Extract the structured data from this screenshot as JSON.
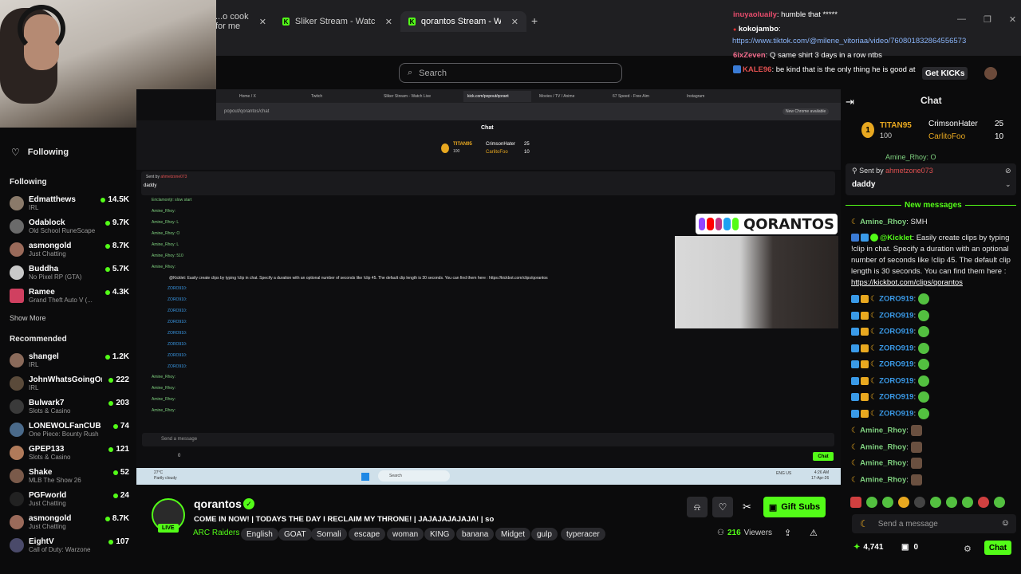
{
  "browser": {
    "tabs": [
      {
        "label": "...o cook for me"
      },
      {
        "label": "Sliker Stream - Watch Live on K"
      },
      {
        "label": "qorantos Stream - Watch Live o"
      }
    ],
    "new_tab": "+"
  },
  "topbar": {
    "search_placeholder": "Search",
    "get_kicks": "Get KICKs"
  },
  "overlay_chat": [
    {
      "user": "inuyaoluaily",
      "text": ": humble that *****",
      "color": "#e74c6c"
    },
    {
      "user": "kokojambo",
      "text": ":",
      "color": "#ffffff"
    },
    {
      "user": "",
      "text": "https://www.tiktok.com/@milene_vitoriaa/video/760801832864556573",
      "color": "#8ab4f8"
    },
    {
      "user": "6ixZeven",
      "text": ": Q same shirt 3 days in a row ntbs",
      "color": "#f06a8a"
    },
    {
      "user": "KALE96",
      "text": ": be kind that is the only thing he is good at",
      "color": "#e05050"
    }
  ],
  "sidebar": {
    "following_header": "Following",
    "following_section": "Following",
    "following": [
      {
        "name": "Edmatthews",
        "category": "IRL",
        "viewers": "14.5K"
      },
      {
        "name": "Odablock",
        "category": "Old School RuneScape",
        "viewers": "9.7K"
      },
      {
        "name": "asmongold",
        "category": "Just Chatting",
        "viewers": "8.7K"
      },
      {
        "name": "Buddha",
        "category": "No Pixel RP (GTA)",
        "viewers": "5.7K"
      },
      {
        "name": "Ramee",
        "category": "Grand Theft Auto V (...",
        "viewers": "4.3K"
      }
    ],
    "show_more": "Show More",
    "recommended_section": "Recommended",
    "recommended": [
      {
        "name": "shangel",
        "category": "IRL",
        "viewers": "1.2K"
      },
      {
        "name": "JohnWhatsGoingOn",
        "category": "IRL",
        "viewers": "222"
      },
      {
        "name": "Bulwark7",
        "category": "Slots & Casino",
        "viewers": "203"
      },
      {
        "name": "LONEWOLFanCUB",
        "category": "One Piece: Bounty Rush",
        "viewers": "74"
      },
      {
        "name": "GPEP133",
        "category": "Slots & Casino",
        "viewers": "121"
      },
      {
        "name": "Shake",
        "category": "MLB The Show 26",
        "viewers": "52"
      },
      {
        "name": "PGFworld",
        "category": "Just Chatting",
        "viewers": "24"
      },
      {
        "name": "asmongold",
        "category": "Just Chatting",
        "viewers": "8.7K"
      },
      {
        "name": "EightV",
        "category": "Call of Duty: Warzone",
        "viewers": "107"
      }
    ]
  },
  "inner_window": {
    "tabs": [
      "Home / X",
      "Twitch",
      "Sliker Stream - Watch Live",
      "kick.com/popout/qorant",
      "Movies / TV / Anime",
      "67 Speed - Free Aim",
      "Instagram"
    ],
    "address": "popout/qorantos/chat",
    "chat_title": "Chat",
    "chrome_update": "New Chrome available",
    "top_user": "TITAN95",
    "top_user_count": "100",
    "second_user": "CrimsonHater",
    "second_count": "25",
    "third_user": "CarlitoFoo",
    "third_count": "10",
    "pinned_sent_by": "Sent by",
    "pinned_author": "ahmetzone073",
    "pinned_text": "daddy",
    "lines": [
      "Ericlamontjr: slow start",
      "Amine_Rhoy:",
      "Amine_Rhoy: L",
      "Amine_Rhoy: O",
      "Amine_Rhoy: L",
      "Amine_Rhoy: 510",
      "Amine_Rhoy:",
      "@Kicklet: Easily create clips by typing !clip in chat. Specify a duration with an optional number of seconds like !clip 45. The default clip length is 30 seconds. You can find them here : https://kickbot.com/clips/qorantos",
      "ZORO910:",
      "ZORO910:",
      "ZORO910:",
      "ZORO910:",
      "ZORO910:",
      "ZORO910:",
      "ZORO910:",
      "ZORO910:",
      "Amine_Rhoy:",
      "Amine_Rhoy:",
      "Amine_Rhoy:",
      "Amine_Rhoy:"
    ],
    "send_placeholder": "Send a message",
    "kicks": "0",
    "chat_button": "Chat",
    "overlay_brand": "QORANTOS",
    "taskbar_search": "Search",
    "weather_temp": "27°C",
    "weather_desc": "Partly cloudy",
    "taskbar_time": "4:26 AM",
    "taskbar_date": "17-Apr-26",
    "taskbar_lang": "ENG US"
  },
  "right_chat": {
    "title": "Chat",
    "top_user": "TITAN95",
    "top_user_count": "100",
    "second_user": "CrimsonHater",
    "second_count": "25",
    "third_user": "CarlitoFoo",
    "third_count": "10",
    "cut_user": "Amine_Rhoy: O",
    "pinned_sent_by": "Sent by",
    "pinned_author": "ahmetzone073",
    "pinned_text": "daddy",
    "new_messages": "New messages",
    "messages": [
      {
        "user": "Amine_Rhoy",
        "text": ": SMH"
      },
      {
        "user": "@Kicklet",
        "text": ": Easily create clips by typing !clip in chat. Specify a duration with an optional number of seconds like !clip 45. The default clip length is 30 seconds. You can find them here : ",
        "link": "https://kickbot.com/clips/qorantos"
      }
    ],
    "zoro_lines": [
      "ZORO919",
      "ZORO919",
      "ZORO919",
      "ZORO919",
      "ZORO919",
      "ZORO919",
      "ZORO919",
      "ZORO919"
    ],
    "amine_lines": [
      "Amine_Rhoy",
      "Amine_Rhoy",
      "Amine_Rhoy",
      "Amine_Rhoy"
    ],
    "send_placeholder": "Send a message",
    "kicks_balance": "4,741",
    "gift_count": "0",
    "chat_button": "Chat"
  },
  "channel": {
    "name": "qorantos",
    "live_badge": "LIVE",
    "title": "COME IN NOW! | TODAYS THE DAY I RECLAIM MY THRONE! | JAJAJAJAJAJA! | so",
    "category": "ARC Raiders",
    "tags": [
      "English",
      "GOAT",
      "Somali",
      "escape",
      "woman",
      "KING",
      "banana",
      "Midget",
      "gulp",
      "typeracer"
    ],
    "viewers": "216",
    "viewers_label": "Viewers",
    "gift_subs": "Gift Subs"
  },
  "colors": {
    "kick_green": "#53fc18",
    "background": "#0b0b0c",
    "panel": "#1f1f22",
    "link": "#8ab4f8"
  }
}
